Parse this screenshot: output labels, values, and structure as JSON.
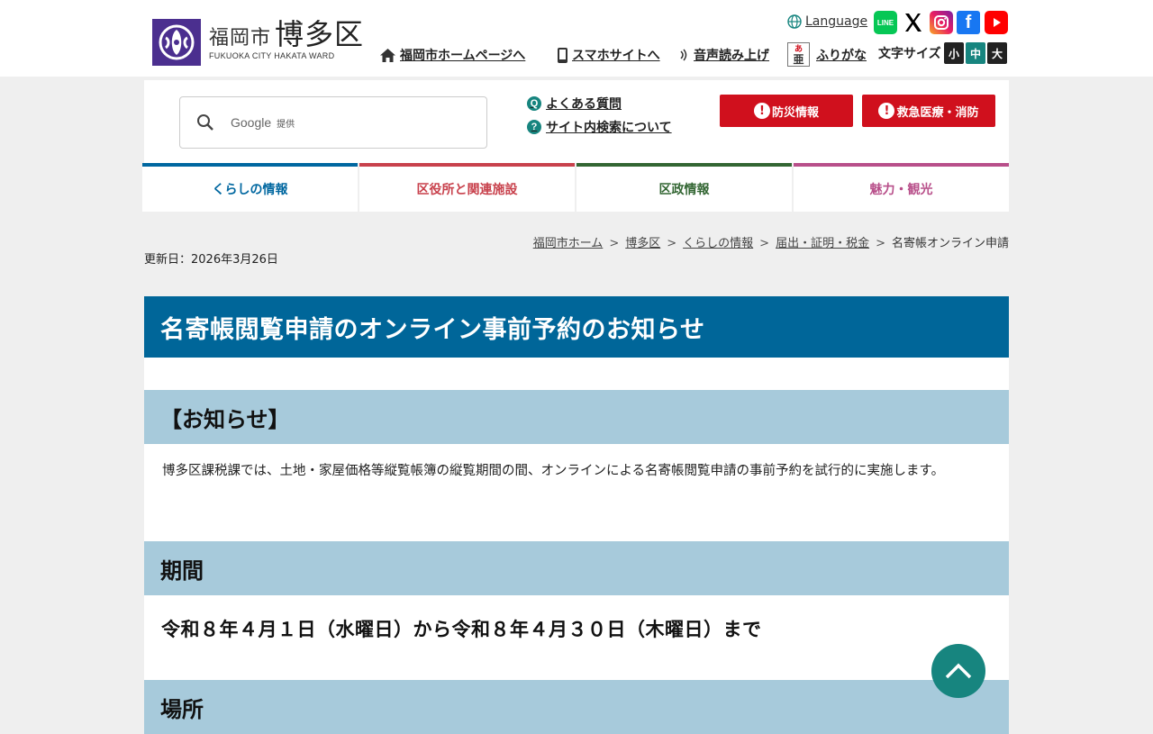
{
  "header": {
    "logo_city": "福岡市",
    "logo_ward": "博多区",
    "logo_en": "FUKUOKA CITY HAKATA WARD",
    "language": "Language",
    "links": {
      "home": "福岡市ホームページへ",
      "smartphone": "スマホサイトへ",
      "voice": "音声読み上げ",
      "furigana": "ふりがな"
    },
    "social": [
      "LINE",
      "X",
      "Instagram",
      "Facebook",
      "YouTube"
    ],
    "font_size": {
      "label": "文字サイズ",
      "small": "小",
      "medium": "中",
      "large": "大"
    }
  },
  "search": {
    "google": "Google",
    "provided": "提供",
    "faq": "よくある質問",
    "about_search": "サイト内検索について",
    "disaster": "防災情報",
    "emergency": "救急医療・消防"
  },
  "nav": [
    {
      "label": "くらしの情報",
      "color": "#0067a0"
    },
    {
      "label": "区役所と関連施設",
      "color": "#c8414c"
    },
    {
      "label": "区政情報",
      "color": "#336633"
    },
    {
      "label": "魅力・観光",
      "color": "#b84f8a"
    }
  ],
  "breadcrumb": [
    "福岡市ホーム",
    "博多区",
    "くらしの情報",
    "届出・証明・税金",
    "名寄帳オンライン申請"
  ],
  "updated": "更新日：2026年3月26日",
  "page": {
    "title": "名寄帳閲覧申請のオンライン事前予約のお知らせ",
    "sections": [
      {
        "heading": "【お知らせ】",
        "text": "博多区課税課では、土地・家屋価格等縦覧帳簿の縦覧期間の間、オンラインによる名寄帳閲覧申請の事前予約を試行的に実施します。"
      },
      {
        "heading": "期間",
        "text": "令和８年４月１日（水曜日）から令和８年４月３０日（木曜日）まで"
      },
      {
        "heading": "場所"
      }
    ]
  },
  "colors": {
    "title_bg": "#006699",
    "section_bg": "#a7cadb",
    "alert_red": "#d0101d",
    "teal": "#17857f"
  }
}
